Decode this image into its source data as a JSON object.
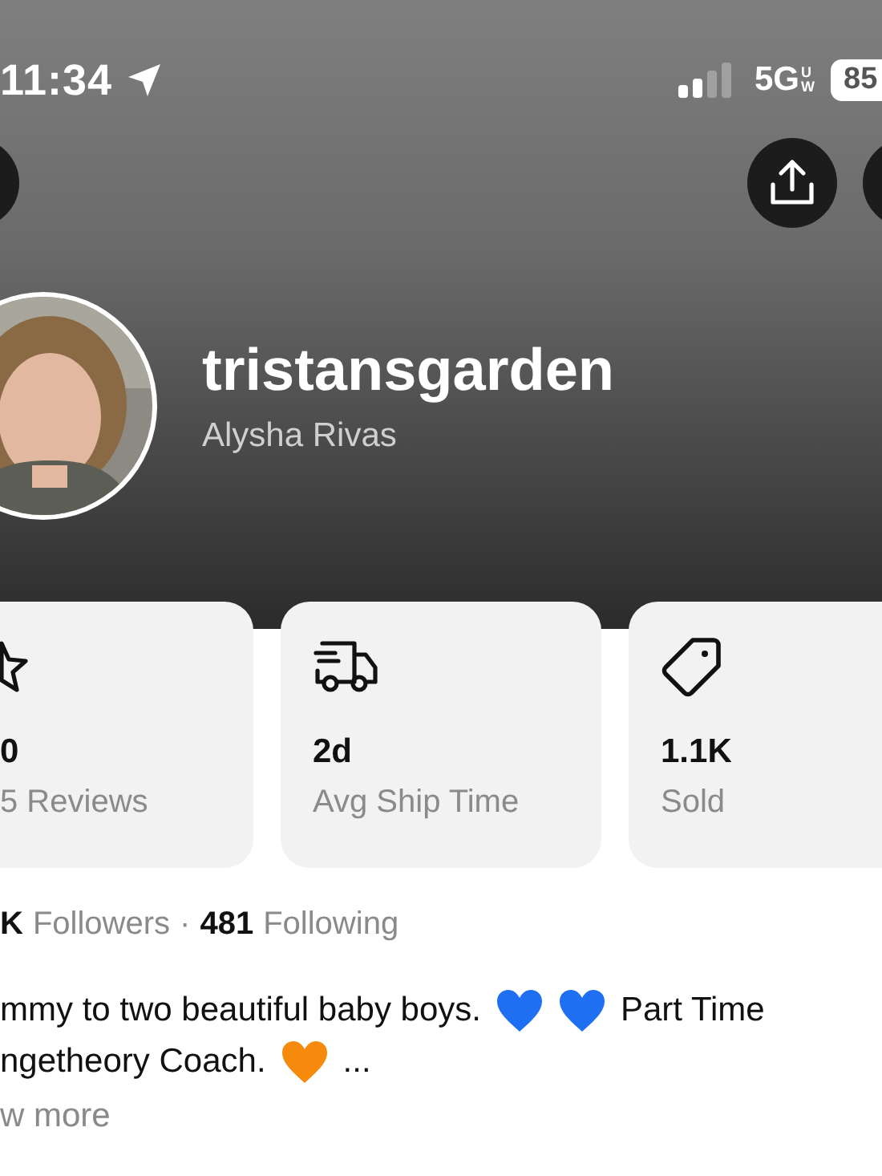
{
  "status_bar": {
    "time": "11:34",
    "network": "5G",
    "network_badge_top": "U",
    "network_badge_bottom": "W",
    "battery": "85"
  },
  "profile": {
    "username": "tristansgarden",
    "name": "Alysha Rivas"
  },
  "stats": [
    {
      "kind": "rating",
      "value": "0",
      "label": "5 Reviews"
    },
    {
      "kind": "shipping",
      "value": "2d",
      "label": "Avg Ship Time"
    },
    {
      "kind": "sold",
      "value": "1.1K",
      "label": "Sold"
    }
  ],
  "follow": {
    "followers_count": "K",
    "followers_label": "Followers",
    "separator": "·",
    "following_count": "481",
    "following_label": "Following"
  },
  "bio": {
    "lines": [
      [
        {
          "kind": "text",
          "text": "mmy to two beautiful baby boys."
        },
        {
          "kind": "heart",
          "color": "#1f6ff2"
        },
        {
          "kind": "heart",
          "color": "#1f6ff2"
        },
        {
          "kind": "text",
          "text": "Part Time"
        }
      ],
      [
        {
          "kind": "text",
          "text": "ngetheory Coach."
        },
        {
          "kind": "heart",
          "color": "#f58a0c"
        },
        {
          "kind": "text",
          "text": "..."
        }
      ]
    ],
    "more": "w more"
  }
}
